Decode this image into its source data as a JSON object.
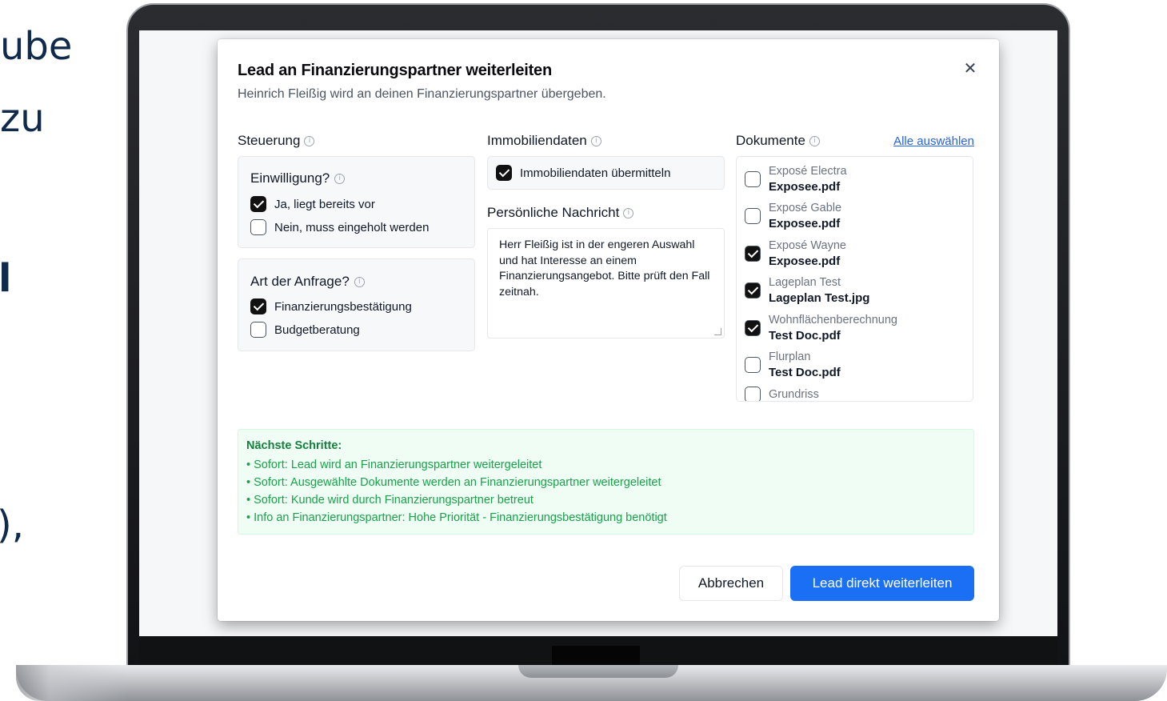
{
  "background": {
    "fragments": [
      "ube",
      "zu",
      "l",
      "),"
    ]
  },
  "modal": {
    "title": "Lead an Finanzierungspartner weiterleiten",
    "subtitle": "Heinrich Fleißig wird an deinen Finanzierungspartner übergeben.",
    "close_icon": "close-icon"
  },
  "steuerung": {
    "heading": "Steuerung",
    "einwilligung": {
      "title": "Einwilligung?",
      "options": [
        {
          "label": "Ja, liegt bereits vor",
          "checked": true
        },
        {
          "label": "Nein, muss eingeholt werden",
          "checked": false
        }
      ]
    },
    "anfrage": {
      "title": "Art der Anfrage?",
      "options": [
        {
          "label": "Finanzierungsbestätigung",
          "checked": true
        },
        {
          "label": "Budgetberatung",
          "checked": false
        }
      ]
    }
  },
  "immobilien": {
    "heading": "Immobiliendaten",
    "transfer_label": "Immobiliendaten übermitteln",
    "transfer_checked": true,
    "message_heading": "Persönliche Nachricht",
    "message_text": "Herr Fleißig ist in der engeren Auswahl und hat Interesse an einem Finanzierungsangebot. Bitte prüft den Fall zeitnah."
  },
  "dokumente": {
    "heading": "Dokumente",
    "select_all": "Alle auswählen",
    "items": [
      {
        "name": "Exposé Electra",
        "file": "Exposee.pdf",
        "checked": false
      },
      {
        "name": "Exposé Gable",
        "file": "Exposee.pdf",
        "checked": false
      },
      {
        "name": "Exposé Wayne",
        "file": "Exposee.pdf",
        "checked": true
      },
      {
        "name": "Lageplan Test",
        "file": "Lageplan Test.jpg",
        "checked": true
      },
      {
        "name": "Wohnflächenberechnung",
        "file": "Test Doc.pdf",
        "checked": true
      },
      {
        "name": "Flurplan",
        "file": "Test Doc.pdf",
        "checked": false
      },
      {
        "name": "Grundriss",
        "file": "",
        "checked": false
      }
    ]
  },
  "next_steps": {
    "heading": "Nächste Schritte:",
    "items": [
      "• Sofort: Lead wird an Finanzierungspartner weitergeleitet",
      "• Sofort: Ausgewählte Dokumente werden an Finanzierungspartner weitergeleitet",
      "• Sofort: Kunde wird durch Finanzierungspartner betreut",
      "• Info an Finanzierungspartner: Hohe Priorität - Finanzierungsbestätigung benötigt"
    ]
  },
  "actions": {
    "cancel": "Abbrechen",
    "submit": "Lead direkt weiterleiten"
  },
  "colors": {
    "primary": "#1a6ff5",
    "success_text": "#16a34a",
    "success_bg": "#f0fdf4",
    "link": "#2563eb"
  }
}
